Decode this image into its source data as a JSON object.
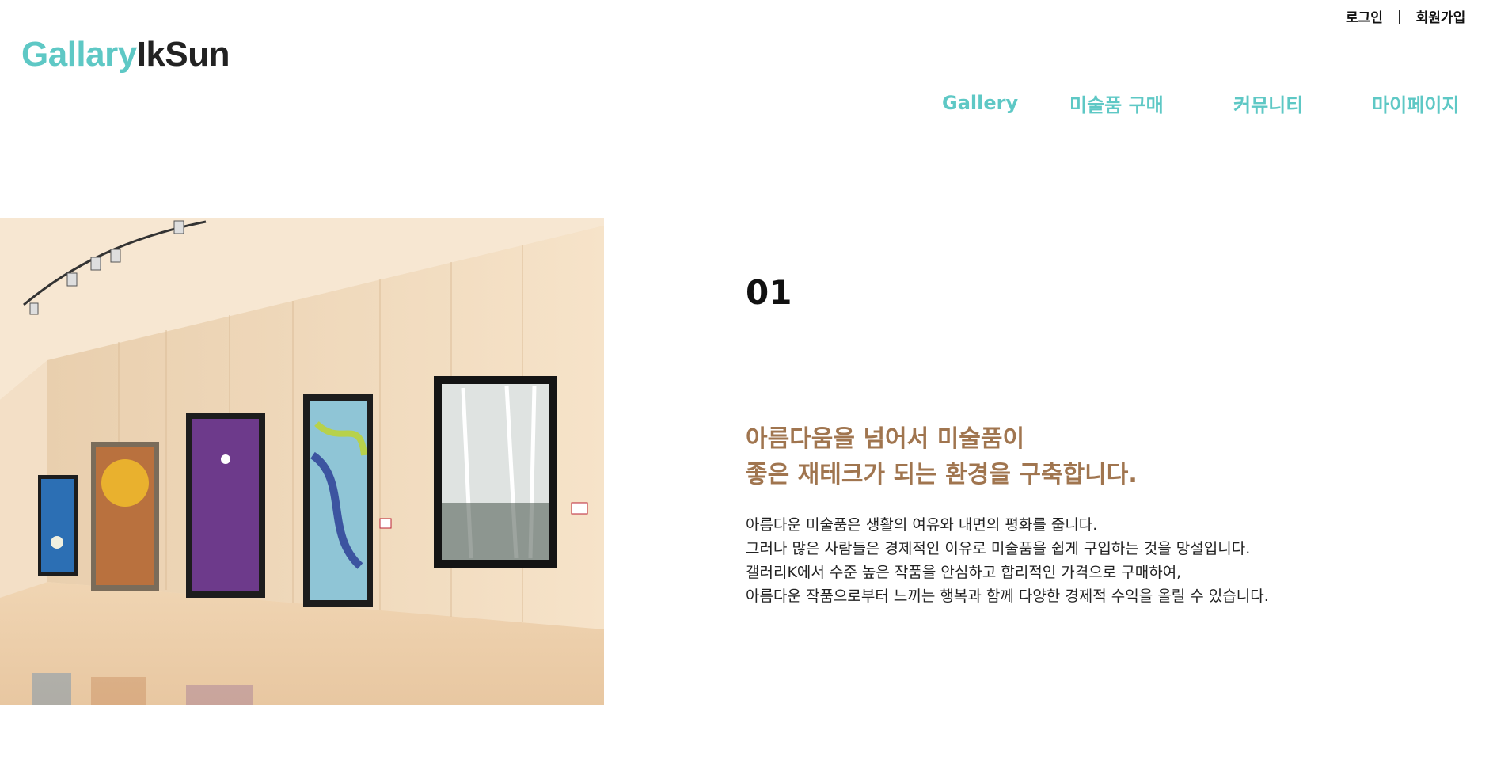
{
  "utility": {
    "login": "로그인",
    "separator": "|",
    "signup": "회원가입"
  },
  "logo": {
    "part1": "Gallary",
    "part2": "IkSun"
  },
  "nav": [
    "Gallery",
    "미술품 구매",
    "커뮤니티",
    "마이페이지"
  ],
  "colors": {
    "accent": "#5ec8c5",
    "headline": "#a0754f",
    "text": "#222222"
  },
  "section": {
    "number": "01",
    "headline": [
      "아름다움을 넘어서 미술품이",
      "좋은 재테크가 되는 환경을 구축합니다."
    ],
    "body": [
      "아름다운 미술품은 생활의 여유와 내면의 평화를 줍니다.",
      "그러나 많은 사람들은 경제적인 이유로 미술품을 쉽게 구입하는 것을 망설입니다.",
      "갤러리K에서 수준 높은 작품을 안심하고 합리적인 가격으로 구매하여,",
      "아름다운 작품으로부터 느끼는 행복과 함께 다양한 경제적 수익을 올릴 수 있습니다."
    ]
  }
}
